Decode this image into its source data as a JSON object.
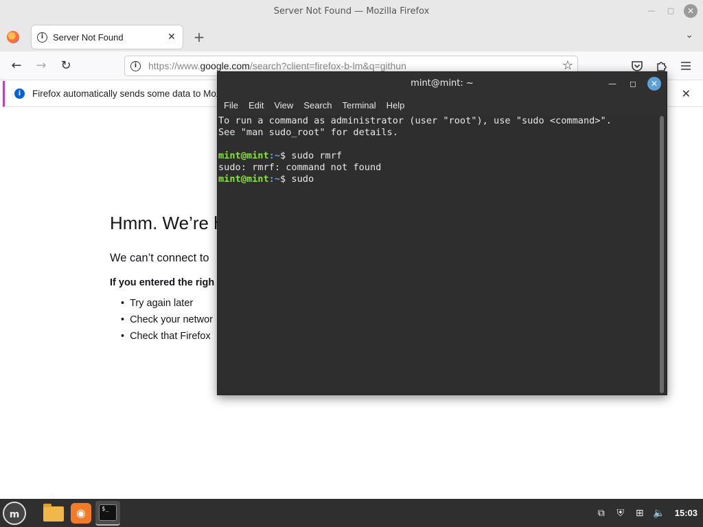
{
  "firefox": {
    "window_title": "Server Not Found — Mozilla Firefox",
    "tab": {
      "title": "Server Not Found",
      "close_glyph": "✕"
    },
    "new_tab_glyph": "+",
    "tab_list_glyph": "⌄",
    "nav": {
      "back": "←",
      "forward": "→",
      "reload": "↻"
    },
    "url": {
      "prefix": "https://www.",
      "host": "google.com",
      "rest": "/search?client=firefox-b-lm&q=githun"
    },
    "star_glyph": "☆",
    "toolbar_icons": [
      "pocket-icon",
      "extensions-icon",
      "menu-icon"
    ],
    "notification": {
      "text": "Firefox automatically sends some data to Moz",
      "close_glyph": "✕"
    },
    "error": {
      "title": "Hmm. We’re h",
      "description": "We can’t connect to",
      "bold": "If you entered the righ",
      "suggestions": [
        "Try again later",
        "Check your networ",
        "Check that Firefox"
      ]
    }
  },
  "terminal": {
    "title": "mint@mint: ~",
    "menu": [
      "File",
      "Edit",
      "View",
      "Search",
      "Terminal",
      "Help"
    ],
    "lines": [
      {
        "text": "To run a command as administrator (user \"root\"), use \"sudo <command>\"."
      },
      {
        "text": "See \"man sudo_root\" for details."
      },
      {
        "text": ""
      },
      {
        "user": "mint@mint",
        "path": ":~",
        "cmd": "$ sudo rmrf"
      },
      {
        "text": "sudo: rmrf: command not found"
      },
      {
        "user": "mint@mint",
        "path": ":~",
        "cmd": "$ sudo"
      }
    ]
  },
  "taskbar": {
    "apps": [
      "file-manager",
      "firefox",
      "terminal"
    ],
    "clock": "15:03"
  },
  "colors": {
    "prompt_user": "#8ae234",
    "prompt_path": "#729fcf",
    "terminal_bg": "#2e2e2e",
    "notification_accent": "#c33cc6"
  }
}
